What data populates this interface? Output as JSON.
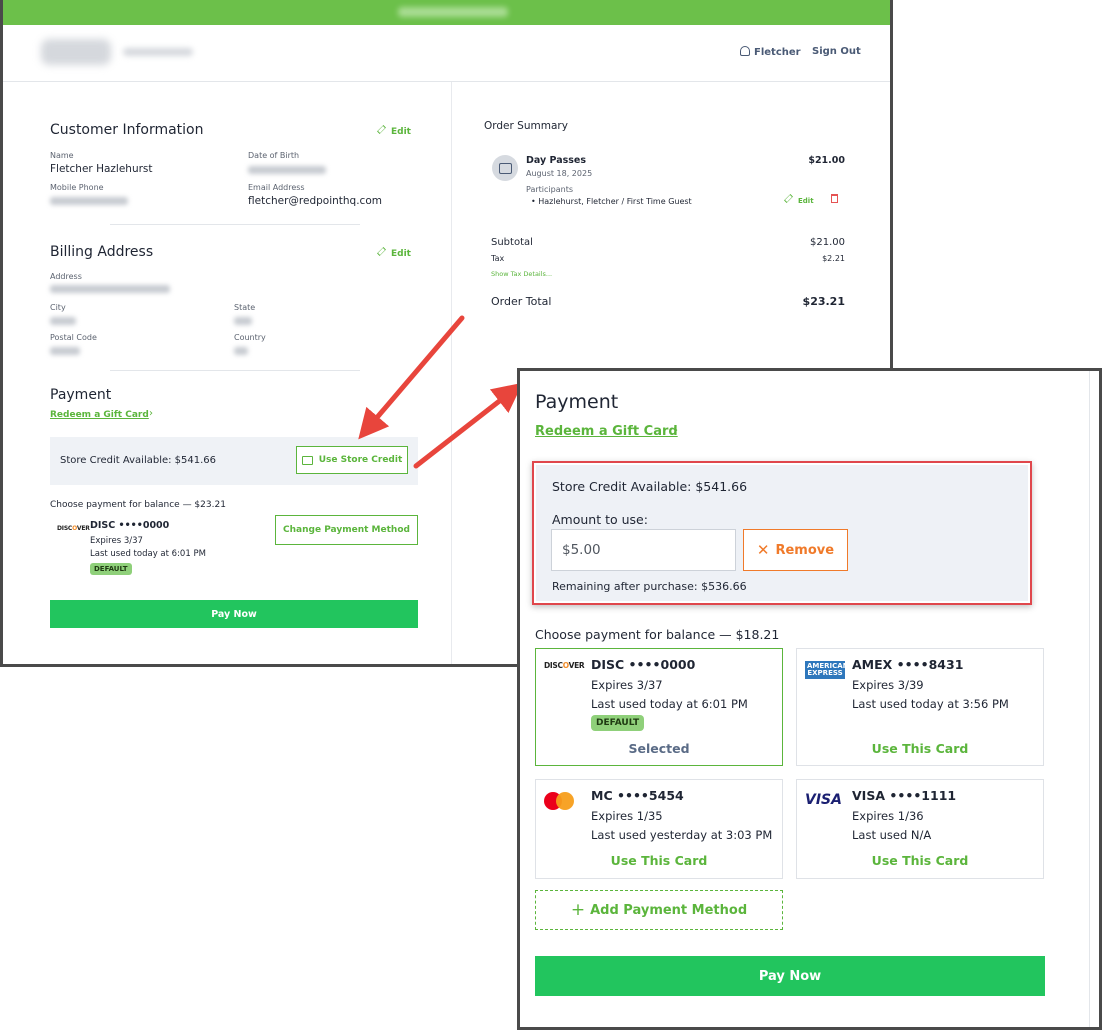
{
  "header": {
    "user_name": "Fletcher",
    "sign_out": "Sign Out"
  },
  "customer": {
    "title": "Customer Information",
    "edit": "Edit",
    "name_label": "Name",
    "name_value": "Fletcher Hazlehurst",
    "dob_label": "Date of Birth",
    "phone_label": "Mobile Phone",
    "email_label": "Email Address",
    "email_value": "fletcher@redpointhq.com"
  },
  "billing": {
    "title": "Billing Address",
    "edit": "Edit",
    "address_label": "Address",
    "city_label": "City",
    "state_label": "State",
    "postal_label": "Postal Code",
    "country_label": "Country"
  },
  "payment": {
    "title": "Payment",
    "redeem": "Redeem a Gift Card",
    "store_credit": "Store Credit Available: $541.66",
    "use_store_credit": "Use Store Credit",
    "choose_balance": "Choose payment for balance — $23.21",
    "card_name": "DISC ••••0000",
    "card_expires": "Expires 3/37",
    "card_last_used": "Last used today at 6:01 PM",
    "default_badge": "DEFAULT",
    "change_method": "Change Payment Method",
    "pay_now": "Pay Now"
  },
  "order_summary": {
    "title": "Order Summary",
    "item_name": "Day Passes",
    "item_date": "August 18, 2025",
    "item_price": "$21.00",
    "participants_label": "Participants",
    "participant": "Hazlehurst, Fletcher / First Time Guest",
    "edit": "Edit",
    "subtotal_label": "Subtotal",
    "subtotal_value": "$21.00",
    "tax_label": "Tax",
    "tax_value": "$2.21",
    "show_tax": "Show Tax Details...",
    "total_label": "Order Total",
    "total_value": "$23.21"
  },
  "zoom": {
    "title": "Payment",
    "redeem": "Redeem a Gift Card",
    "store_credit": "Store Credit Available: $541.66",
    "amount_label": "Amount to use:",
    "amount_value": "$5.00",
    "remove": "Remove",
    "remaining": "Remaining after purchase: $536.66",
    "choose_balance": "Choose payment for balance — $18.21",
    "default_badge": "DEFAULT",
    "cards": [
      {
        "brand": "DISCOVER",
        "name": "DISC ••••0000",
        "expires": "Expires 3/37",
        "last_used": "Last used today at 6:01 PM",
        "action": "Selected"
      },
      {
        "brand": "AMERICAN EXPRESS",
        "name": "AMEX ••••8431",
        "expires": "Expires 3/39",
        "last_used": "Last used today at 3:56 PM",
        "action": "Use This Card"
      },
      {
        "brand": "mastercard",
        "name": "MC ••••5454",
        "expires": "Expires 1/35",
        "last_used": "Last used yesterday at 3:03 PM",
        "action": "Use This Card"
      },
      {
        "brand": "VISA",
        "name": "VISA ••••1111",
        "expires": "Expires 1/36",
        "last_used": "Last used N/A",
        "action": "Use This Card"
      }
    ],
    "add_method": "Add Payment Method",
    "pay_now": "Pay Now"
  },
  "colors": {
    "brand_green": "#5bb53c",
    "pay_green": "#22c55e",
    "arrow_red": "#e8453c",
    "remove_orange": "#f07a2a"
  }
}
